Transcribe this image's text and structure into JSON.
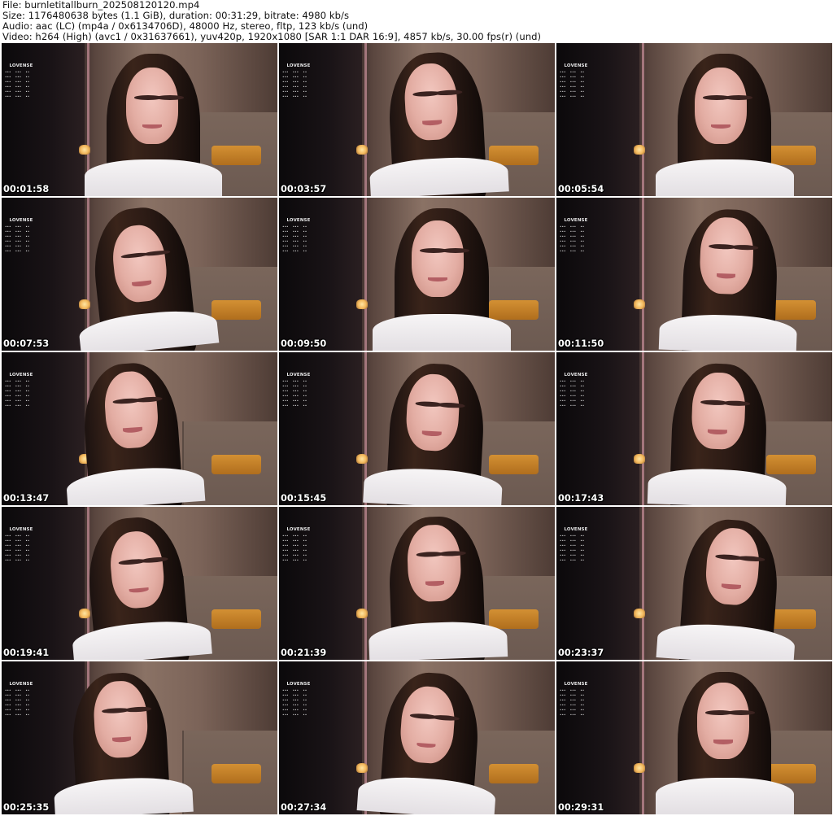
{
  "header": {
    "file_line": "File: burnletitallburn_202508120120.mp4",
    "size_line": "Size: 1176480638 bytes (1.1 GiB), duration: 00:31:29, bitrate: 4980 kb/s",
    "audio_line": "Audio: aac (LC) (mp4a / 0x6134706D), 48000 Hz, stereo, fltp, 123 kb/s (und)",
    "video_line": "Video: h264 (High) (avc1 / 0x31637661), yuv420p, 1920x1080 [SAR 1:1 DAR 16:9], 4857 kb/s, 30.00 fps(r) (und)"
  },
  "overlay": {
    "brand": "LOVENSE"
  },
  "thumbnails": [
    {
      "timestamp": "00:01:58"
    },
    {
      "timestamp": "00:03:57"
    },
    {
      "timestamp": "00:05:54"
    },
    {
      "timestamp": "00:07:53"
    },
    {
      "timestamp": "00:09:50"
    },
    {
      "timestamp": "00:11:50"
    },
    {
      "timestamp": "00:13:47"
    },
    {
      "timestamp": "00:15:45"
    },
    {
      "timestamp": "00:17:43"
    },
    {
      "timestamp": "00:19:41"
    },
    {
      "timestamp": "00:21:39"
    },
    {
      "timestamp": "00:23:37"
    },
    {
      "timestamp": "00:25:35"
    },
    {
      "timestamp": "00:27:34"
    },
    {
      "timestamp": "00:29:31"
    }
  ],
  "colors": {
    "page_background": "#ffffff",
    "header_text": "#111111",
    "timestamp_text": "#ffffff",
    "timestamp_outline": "#000000"
  }
}
